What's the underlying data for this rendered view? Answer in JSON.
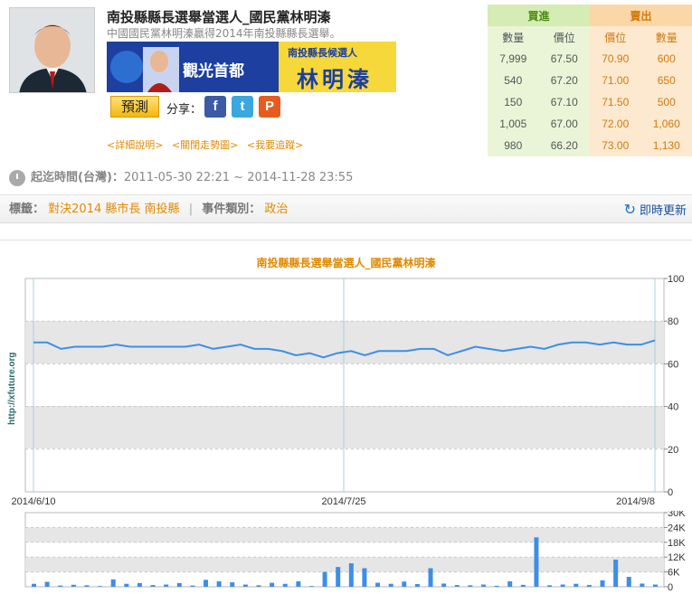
{
  "header": {
    "title": "南投縣縣長選舉當選人_國民黨林明溱",
    "subtitle": "中國國民黨林明溱贏得2014年南投縣縣長選舉。",
    "banner": {
      "left_text": "觀光首都",
      "right_top": "南投縣長候選人",
      "right_name": "林明溱"
    },
    "predict_label": "預測",
    "share_label": "分享：",
    "share_icons": [
      "facebook-icon",
      "twitter-icon",
      "plurk-icon"
    ],
    "links": [
      "<詳細說明>",
      "<關閉走勢圖>",
      "<我要追蹤>"
    ]
  },
  "order_book": {
    "buy_header": "買進",
    "sell_header": "賣出",
    "columns": [
      "數量",
      "價位",
      "價位",
      "數量"
    ],
    "rows": [
      [
        "7,999",
        "67.50",
        "70.90",
        "600"
      ],
      [
        "540",
        "67.20",
        "71.00",
        "650"
      ],
      [
        "150",
        "67.10",
        "71.50",
        "500"
      ],
      [
        "1,005",
        "67.00",
        "72.00",
        "1,060"
      ],
      [
        "980",
        "66.20",
        "73.00",
        "1,130"
      ]
    ]
  },
  "period": {
    "label": "起迄時間(台灣)：",
    "value": "2011-05-30 22:21 ~ 2014-11-28 23:55"
  },
  "tagbar": {
    "tags_label": "標籤：",
    "tags": [
      "對決2014",
      "縣市長",
      "南投縣"
    ],
    "category_label": "事件類別：",
    "category": "政治",
    "refresh_label": "即時更新"
  },
  "colors": {
    "accent": "#e08a00",
    "line": "#3d8ee8",
    "band": "#e6e6e6"
  },
  "chart_data": [
    {
      "type": "line",
      "title": "南投縣縣長選舉當選人_國民黨林明溱",
      "ylabel": "http://xfuture.org",
      "ylim": [
        0,
        100
      ],
      "yticks": [
        "0",
        "20",
        "40",
        "60",
        "80",
        "100"
      ],
      "xticks": [
        "2014/6/10",
        "2014/7/25",
        "2014/9/8"
      ],
      "x_days": [
        0,
        2,
        4,
        6,
        8,
        10,
        12,
        14,
        16,
        18,
        20,
        22,
        24,
        26,
        28,
        30,
        32,
        34,
        36,
        38,
        40,
        42,
        44,
        46,
        48,
        50,
        52,
        54,
        56,
        58,
        60,
        62,
        64,
        66,
        68,
        70,
        72,
        74,
        76,
        78,
        80,
        82,
        84,
        86,
        88,
        90
      ],
      "values": [
        70,
        70,
        67,
        68,
        68,
        68,
        69,
        68,
        68,
        68,
        68,
        68,
        69,
        67,
        68,
        69,
        67,
        67,
        66,
        64,
        65,
        63,
        65,
        66,
        64,
        66,
        66,
        66,
        67,
        67,
        64,
        66,
        68,
        67,
        66,
        67,
        68,
        67,
        69,
        70,
        70,
        69,
        70,
        69,
        69,
        71
      ]
    },
    {
      "type": "bar",
      "ylim": [
        0,
        30000
      ],
      "yticks": [
        "0",
        "6K",
        "12K",
        "18K",
        "24K",
        "30K"
      ],
      "volumes": [
        1200,
        2000,
        500,
        800,
        600,
        300,
        3000,
        1200,
        1500,
        700,
        900,
        1500,
        500,
        2800,
        2200,
        1800,
        900,
        600,
        1600,
        1200,
        2200,
        300,
        6000,
        8000,
        9500,
        7500,
        1600,
        1200,
        2100,
        1100,
        7500,
        1300,
        700,
        600,
        900,
        400,
        2200,
        800,
        20000,
        600,
        900,
        1200,
        700,
        2600,
        11000,
        4000,
        1300,
        900
      ]
    }
  ]
}
